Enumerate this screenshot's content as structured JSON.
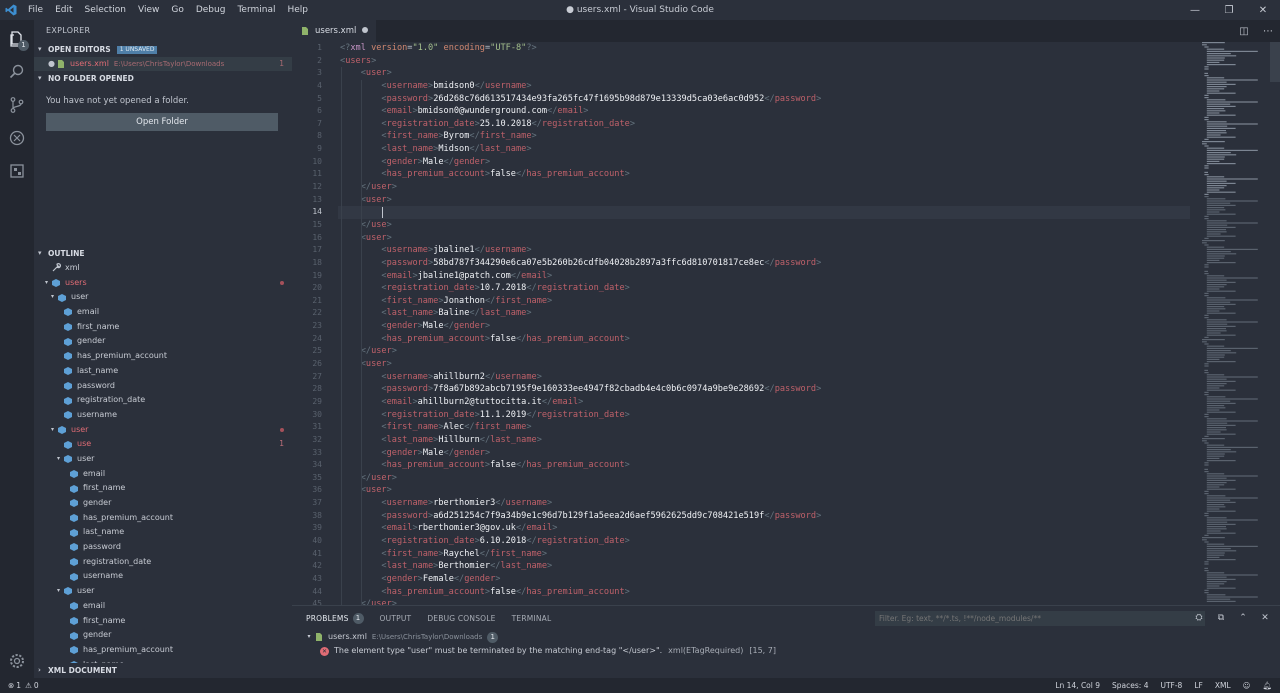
{
  "window": {
    "title": "● users.xml - Visual Studio Code",
    "menu": [
      "File",
      "Edit",
      "Selection",
      "View",
      "Go",
      "Debug",
      "Terminal",
      "Help"
    ],
    "controls": [
      "—",
      "❐",
      "✕"
    ]
  },
  "activity": {
    "explorer_badge": "1",
    "icons": [
      "files-icon",
      "search-icon",
      "source-control-icon",
      "debug-icon",
      "extensions-icon",
      "settings-gear-icon"
    ]
  },
  "sidebar": {
    "title": "EXPLORER",
    "open_editors": {
      "label": "OPEN EDITORS",
      "badge": "1 UNSAVED",
      "file": {
        "name": "users.xml",
        "path": "E:\\Users\\ChrisTaylor\\Downloads",
        "count": "1"
      }
    },
    "no_folder": {
      "label": "NO FOLDER OPENED",
      "message": "You have not yet opened a folder.",
      "button": "Open Folder"
    },
    "outline": {
      "label": "OUTLINE",
      "items": [
        {
          "label": "xml",
          "depth": 0,
          "twisty": "",
          "icon": "wrench",
          "err": false,
          "mark": ""
        },
        {
          "label": "users",
          "depth": 0,
          "twisty": "▾",
          "icon": "tag",
          "err": true,
          "mark": "dot"
        },
        {
          "label": "user",
          "depth": 1,
          "twisty": "▾",
          "icon": "tag",
          "err": false,
          "mark": ""
        },
        {
          "label": "email",
          "depth": 2,
          "twisty": "",
          "icon": "tag",
          "err": false,
          "mark": ""
        },
        {
          "label": "first_name",
          "depth": 2,
          "twisty": "",
          "icon": "tag",
          "err": false,
          "mark": ""
        },
        {
          "label": "gender",
          "depth": 2,
          "twisty": "",
          "icon": "tag",
          "err": false,
          "mark": ""
        },
        {
          "label": "has_premium_account",
          "depth": 2,
          "twisty": "",
          "icon": "tag",
          "err": false,
          "mark": ""
        },
        {
          "label": "last_name",
          "depth": 2,
          "twisty": "",
          "icon": "tag",
          "err": false,
          "mark": ""
        },
        {
          "label": "password",
          "depth": 2,
          "twisty": "",
          "icon": "tag",
          "err": false,
          "mark": ""
        },
        {
          "label": "registration_date",
          "depth": 2,
          "twisty": "",
          "icon": "tag",
          "err": false,
          "mark": ""
        },
        {
          "label": "username",
          "depth": 2,
          "twisty": "",
          "icon": "tag",
          "err": false,
          "mark": ""
        },
        {
          "label": "user",
          "depth": 1,
          "twisty": "▾",
          "icon": "tag",
          "err": true,
          "mark": "dot"
        },
        {
          "label": "use",
          "depth": 2,
          "twisty": "",
          "icon": "tag",
          "err": true,
          "mark": "1"
        },
        {
          "label": "user",
          "depth": 2,
          "twisty": "▾",
          "icon": "tag",
          "err": false,
          "mark": ""
        },
        {
          "label": "email",
          "depth": 3,
          "twisty": "",
          "icon": "tag",
          "err": false,
          "mark": ""
        },
        {
          "label": "first_name",
          "depth": 3,
          "twisty": "",
          "icon": "tag",
          "err": false,
          "mark": ""
        },
        {
          "label": "gender",
          "depth": 3,
          "twisty": "",
          "icon": "tag",
          "err": false,
          "mark": ""
        },
        {
          "label": "has_premium_account",
          "depth": 3,
          "twisty": "",
          "icon": "tag",
          "err": false,
          "mark": ""
        },
        {
          "label": "last_name",
          "depth": 3,
          "twisty": "",
          "icon": "tag",
          "err": false,
          "mark": ""
        },
        {
          "label": "password",
          "depth": 3,
          "twisty": "",
          "icon": "tag",
          "err": false,
          "mark": ""
        },
        {
          "label": "registration_date",
          "depth": 3,
          "twisty": "",
          "icon": "tag",
          "err": false,
          "mark": ""
        },
        {
          "label": "username",
          "depth": 3,
          "twisty": "",
          "icon": "tag",
          "err": false,
          "mark": ""
        },
        {
          "label": "user",
          "depth": 2,
          "twisty": "▾",
          "icon": "tag",
          "err": false,
          "mark": ""
        },
        {
          "label": "email",
          "depth": 3,
          "twisty": "",
          "icon": "tag",
          "err": false,
          "mark": ""
        },
        {
          "label": "first_name",
          "depth": 3,
          "twisty": "",
          "icon": "tag",
          "err": false,
          "mark": ""
        },
        {
          "label": "gender",
          "depth": 3,
          "twisty": "",
          "icon": "tag",
          "err": false,
          "mark": ""
        },
        {
          "label": "has_premium_account",
          "depth": 3,
          "twisty": "",
          "icon": "tag",
          "err": false,
          "mark": ""
        },
        {
          "label": "last_name",
          "depth": 3,
          "twisty": "",
          "icon": "tag",
          "err": false,
          "mark": ""
        }
      ]
    },
    "xml_document": "XML DOCUMENT"
  },
  "editor": {
    "tab": {
      "name": "users.xml"
    },
    "tab_actions": [
      "◫",
      "⋯"
    ],
    "current_line": 14,
    "lines": [
      {
        "i": 0,
        "k": "decl"
      },
      {
        "i": 0,
        "k": "open",
        "tag": "users"
      },
      {
        "i": 1,
        "k": "open",
        "tag": "user"
      },
      {
        "i": 2,
        "k": "el",
        "tag": "username",
        "v": "bmidson0"
      },
      {
        "i": 2,
        "k": "el",
        "tag": "password",
        "v": "26d268c76d613517434e93fa265fc47f1695b98d879e13339d5ca03e6ac0d952"
      },
      {
        "i": 2,
        "k": "el",
        "tag": "email",
        "v": "bmidson0@wunderground.com"
      },
      {
        "i": 2,
        "k": "el",
        "tag": "registration_date",
        "v": "25.10.2018"
      },
      {
        "i": 2,
        "k": "el",
        "tag": "first_name",
        "v": "Byrom"
      },
      {
        "i": 2,
        "k": "el",
        "tag": "last_name",
        "v": "Midson"
      },
      {
        "i": 2,
        "k": "el",
        "tag": "gender",
        "v": "Male"
      },
      {
        "i": 2,
        "k": "el",
        "tag": "has_premium_account",
        "v": "false"
      },
      {
        "i": 1,
        "k": "close",
        "tag": "user"
      },
      {
        "i": 1,
        "k": "open",
        "tag": "user"
      },
      {
        "i": 2,
        "k": "empty"
      },
      {
        "i": 1,
        "k": "close",
        "tag": "use"
      },
      {
        "i": 1,
        "k": "open",
        "tag": "user"
      },
      {
        "i": 2,
        "k": "el",
        "tag": "username",
        "v": "jbaline1"
      },
      {
        "i": 2,
        "k": "el",
        "tag": "password",
        "v": "58bd787f344290e6ca07e5b260b26cdfb04028b2897a3ffc6d810701817ce8ec"
      },
      {
        "i": 2,
        "k": "el",
        "tag": "email",
        "v": "jbaline1@patch.com"
      },
      {
        "i": 2,
        "k": "el",
        "tag": "registration_date",
        "v": "10.7.2018"
      },
      {
        "i": 2,
        "k": "el",
        "tag": "first_name",
        "v": "Jonathon"
      },
      {
        "i": 2,
        "k": "el",
        "tag": "last_name",
        "v": "Baline"
      },
      {
        "i": 2,
        "k": "el",
        "tag": "gender",
        "v": "Male"
      },
      {
        "i": 2,
        "k": "el",
        "tag": "has_premium_account",
        "v": "false"
      },
      {
        "i": 1,
        "k": "close",
        "tag": "user"
      },
      {
        "i": 1,
        "k": "open",
        "tag": "user"
      },
      {
        "i": 2,
        "k": "el",
        "tag": "username",
        "v": "ahillburn2"
      },
      {
        "i": 2,
        "k": "el",
        "tag": "password",
        "v": "7f8a67b892abcb7195f9e160333ee4947f82cbadb4e4c0b6c0974a9be9e28692"
      },
      {
        "i": 2,
        "k": "el",
        "tag": "email",
        "v": "ahillburn2@tuttocitta.it"
      },
      {
        "i": 2,
        "k": "el",
        "tag": "registration_date",
        "v": "11.1.2019"
      },
      {
        "i": 2,
        "k": "el",
        "tag": "first_name",
        "v": "Alec"
      },
      {
        "i": 2,
        "k": "el",
        "tag": "last_name",
        "v": "Hillburn"
      },
      {
        "i": 2,
        "k": "el",
        "tag": "gender",
        "v": "Male"
      },
      {
        "i": 2,
        "k": "el",
        "tag": "has_premium_account",
        "v": "false"
      },
      {
        "i": 1,
        "k": "close",
        "tag": "user"
      },
      {
        "i": 1,
        "k": "open",
        "tag": "user"
      },
      {
        "i": 2,
        "k": "el",
        "tag": "username",
        "v": "rberthomier3"
      },
      {
        "i": 2,
        "k": "el",
        "tag": "password",
        "v": "a6d251254c7f9a34b9e1c96d7b129f1a5eea2d6aef5962625dd9c708421e519f"
      },
      {
        "i": 2,
        "k": "el",
        "tag": "email",
        "v": "rberthomier3@gov.uk"
      },
      {
        "i": 2,
        "k": "el",
        "tag": "registration_date",
        "v": "6.10.2018"
      },
      {
        "i": 2,
        "k": "el",
        "tag": "first_name",
        "v": "Raychel"
      },
      {
        "i": 2,
        "k": "el",
        "tag": "last_name",
        "v": "Berthomier"
      },
      {
        "i": 2,
        "k": "el",
        "tag": "gender",
        "v": "Female"
      },
      {
        "i": 2,
        "k": "el",
        "tag": "has_premium_account",
        "v": "false"
      },
      {
        "i": 1,
        "k": "close",
        "tag": "user"
      }
    ],
    "decl": {
      "version": "1.0",
      "encoding": "UTF-8"
    }
  },
  "panel": {
    "tabs": [
      {
        "label": "PROBLEMS",
        "badge": "1",
        "active": true
      },
      {
        "label": "OUTPUT",
        "badge": "",
        "active": false
      },
      {
        "label": "DEBUG CONSOLE",
        "badge": "",
        "active": false
      },
      {
        "label": "TERMINAL",
        "badge": "",
        "active": false
      }
    ],
    "filter_placeholder": "Filter. Eg: text, **/*.ts, !**/node_modules/**",
    "actions": [
      "⛭",
      "⧉",
      "⌃",
      "✕"
    ],
    "file": {
      "name": "users.xml",
      "path": "E:\\Users\\ChrisTaylor\\Downloads",
      "count": "1"
    },
    "error": {
      "message": "The element type \"user\" must be terminated by the matching end-tag \"</user>\".",
      "source": "xml(ETagRequired)",
      "location": "[15, 7]"
    }
  },
  "statusbar": {
    "errors": "1",
    "warnings": "0",
    "position": "Ln 14, Col 9",
    "spaces": "Spaces: 4",
    "encoding": "UTF-8",
    "eol": "LF",
    "language": "XML",
    "icons": [
      "smiley-icon",
      "bell-icon"
    ]
  },
  "colors": {
    "background": "#2b303b",
    "tag": "#bf616a",
    "string": "#a3be8c",
    "attribute": "#d08770",
    "error": "#e06c75"
  }
}
